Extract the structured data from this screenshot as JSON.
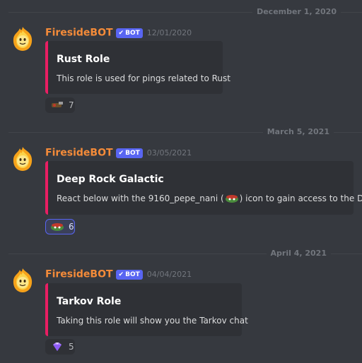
{
  "messages": [
    {
      "date_divider": "December 1, 2020",
      "username": "FiresideBOT",
      "bot_tag": "BOT",
      "timestamp": "12/01/2020",
      "embed": {
        "title": "Rust Role",
        "description": "This role is used for pings related to Rust"
      },
      "reaction": {
        "emoji": "rust-emoji",
        "count": "7",
        "active": false
      }
    },
    {
      "date_divider": "March 5, 2021",
      "username": "FiresideBOT",
      "bot_tag": "BOT",
      "timestamp": "03/05/2021",
      "embed": {
        "title": "Deep Rock Galactic",
        "description_before": "React below with the 9160_pepe_nani (",
        "description_emoji": "pepe-nani-emoji",
        "description_after": ") icon to gain access to the DRG"
      },
      "reaction": {
        "emoji": "pepe-nani-emoji",
        "count": "6",
        "active": true
      }
    },
    {
      "date_divider": "April 4, 2021",
      "username": "FiresideBOT",
      "bot_tag": "BOT",
      "timestamp": "04/04/2021",
      "embed": {
        "title": "Tarkov Role",
        "description": "Taking this role will show you the Tarkov chat"
      },
      "reaction": {
        "emoji": "gem-emoji",
        "count": "5",
        "active": false
      }
    }
  ],
  "colors": {
    "background": "#36393f",
    "embed_background": "#2f3136",
    "embed_accent": "#e91e63",
    "username": "#f48b39",
    "bot_tag": "#5865f2"
  }
}
